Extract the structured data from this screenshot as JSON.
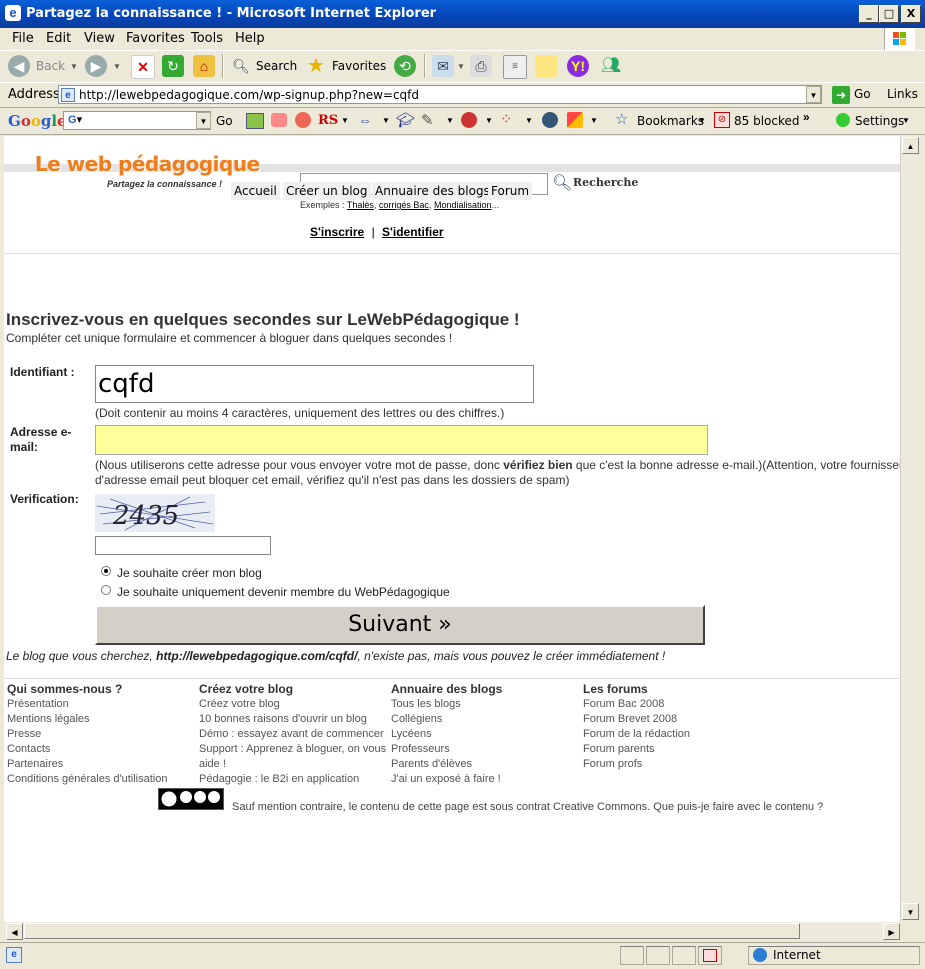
{
  "window": {
    "title": "Partagez la connaissance ! - Microsoft Internet Explorer",
    "minimize": "_",
    "maximize": "□",
    "close": "X"
  },
  "menu": [
    "File",
    "Edit",
    "View",
    "Favorites",
    "Tools",
    "Help"
  ],
  "toolbar": {
    "back": "Back",
    "search": "Search",
    "favorites": "Favorites"
  },
  "address": {
    "label": "Address",
    "url": "http://lewebpedagogique.com/wp-signup.php?new=cqfd",
    "go": "Go",
    "links": "Links"
  },
  "google_toolbar": {
    "logo": "Google",
    "go": "Go",
    "bookmarks": "Bookmarks",
    "blocked": "85 blocked",
    "settings": "Settings"
  },
  "page": {
    "logo": "Le web pédagogique",
    "tagline": "Partagez la connaissance !",
    "nav": [
      "Accueil",
      "Créer un blog",
      "Annuaire des blogs",
      "Forum"
    ],
    "search_button": "Recherche",
    "examples_prefix": "Exemples :",
    "examples": [
      "Thalès",
      "corrigés Bac",
      "Mondialisation"
    ],
    "examples_suffix": "...",
    "signup_link": "S'inscrire",
    "auth_sep": "|",
    "login_link": "S'identifier",
    "heading": "Inscrivez-vous en quelques secondes sur LeWebPédagogique !",
    "subheading": "Compléter cet unique formulaire et commencer à bloguer dans quelques secondes !",
    "form": {
      "username_label": "Identifiant :",
      "username_value": "cqfd",
      "username_hint": "(Doit contenir au moins 4 caractères, uniquement des lettres ou des chiffres.)",
      "email_label_1": "Adresse e-",
      "email_label_2": "mail:",
      "email_value": "",
      "email_hint_1a": "(Nous utiliserons cette adresse pour vous envoyer votre mot de passe, donc ",
      "email_hint_bold": "vérifiez bien",
      "email_hint_1b": " que c'est la bonne adresse e-mail.)(Attention, votre fournisseur",
      "email_hint_2": "d'adresse email peut bloquer cet email, vérifiez qu'il n'est pas dans les dossiers de spam)",
      "verification_label": "Verification:",
      "captcha_text": "2435",
      "verification_value": "",
      "radio_blog": "Je souhaite créer mon blog",
      "radio_member": "Je souhaite uniquement devenir membre du WebPédagogique",
      "submit": "Suivant »"
    },
    "blog_msg_prefix": "Le blog que vous cherchez, ",
    "blog_msg_url": "http://lewebpedagogique.com/cqfd/",
    "blog_msg_suffix": ", n'existe pas, mais vous pouvez le créer immédiatement !",
    "footer": [
      {
        "title": "Qui sommes-nous ?",
        "links": [
          "Présentation",
          "Mentions légales",
          "Presse",
          "Contacts",
          "Partenaires",
          "Conditions générales d'utilisation"
        ]
      },
      {
        "title": "Créez votre blog",
        "links": [
          "Créez votre blog",
          "10 bonnes raisons d'ouvrir un blog",
          "Démo : essayez avant de commencer",
          "Support : Apprenez à bloguer, on vous aide !",
          "Pédagogie : le B2i en application"
        ]
      },
      {
        "title": "Annuaire des blogs",
        "links": [
          "Tous les blogs",
          "Collégiens",
          "Lycéens",
          "Professeurs",
          "Parents d'élèves",
          "J'ai un exposé à faire !"
        ]
      },
      {
        "title": "Les forums",
        "links": [
          "Forum Bac 2008",
          "Forum Brevet 2008",
          "Forum de la rédaction",
          "Forum parents",
          "Forum profs"
        ]
      }
    ],
    "license_text": "Sauf mention contraire, le contenu de cette page est sous contrat Creative Commons. Que puis-je faire avec le contenu ?"
  },
  "status": {
    "zone": "Internet"
  }
}
